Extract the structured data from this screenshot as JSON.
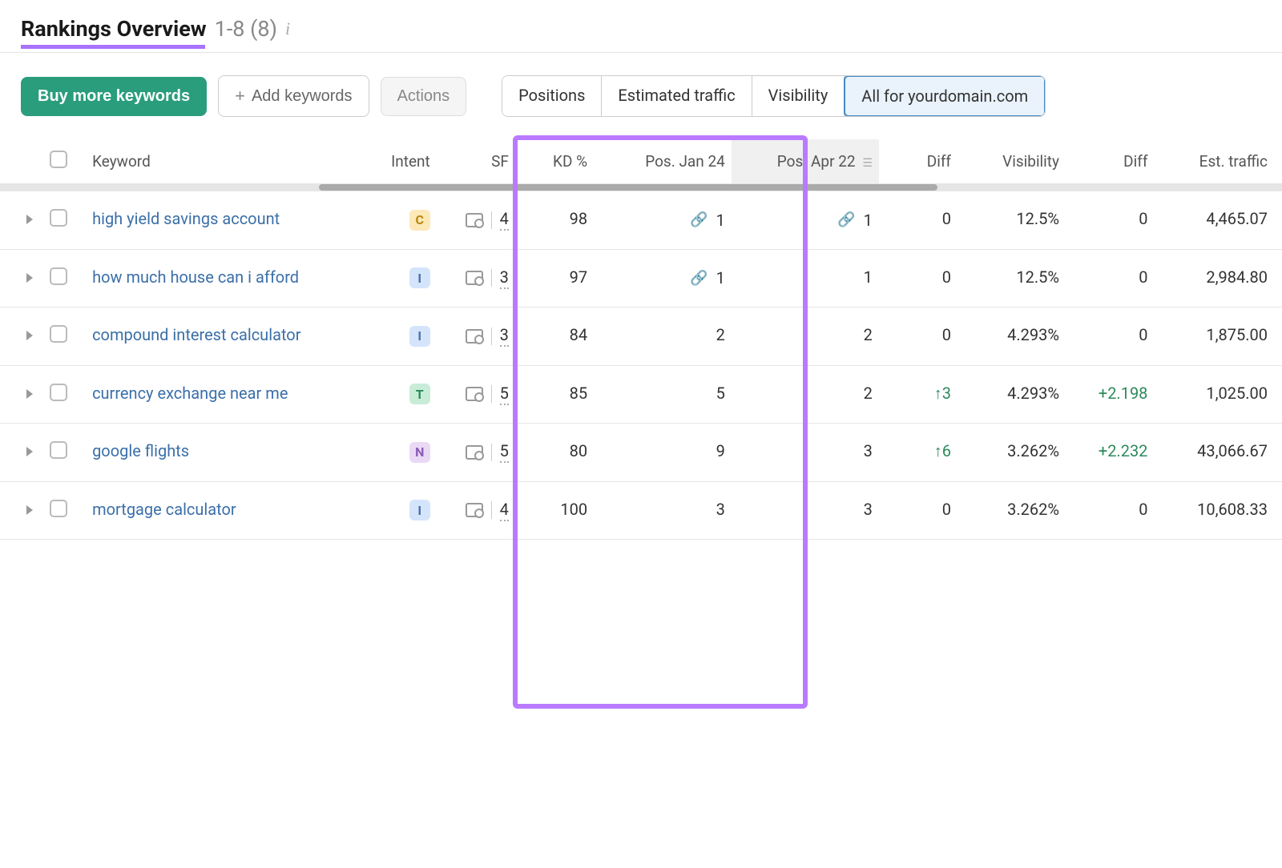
{
  "header": {
    "title": "Rankings Overview",
    "range": "1-8 (8)"
  },
  "toolbar": {
    "buy": "Buy more keywords",
    "add": "Add keywords",
    "actions": "Actions"
  },
  "tabs": {
    "positions": "Positions",
    "traffic": "Estimated traffic",
    "visibility": "Visibility",
    "all": "All for yourdomain.com"
  },
  "columns": {
    "keyword": "Keyword",
    "intent": "Intent",
    "sf": "SF",
    "kd": "KD %",
    "pos1": "Pos. Jan 24",
    "pos2": "Pos. Apr 22",
    "diff1": "Diff",
    "visibility": "Visibility",
    "diff2": "Diff",
    "est": "Est. traffic"
  },
  "rows": [
    {
      "keyword": "high yield savings account",
      "intent": "C",
      "sf": "4",
      "kd": "98",
      "pos1": "1",
      "pos1_icon": true,
      "pos2": "1",
      "pos2_icon": true,
      "diff1": "0",
      "diff1_up": false,
      "vis": "12.5%",
      "diff2": "0",
      "diff2_up": false,
      "est": "4,465.07"
    },
    {
      "keyword": "how much house can i afford",
      "intent": "I",
      "sf": "3",
      "kd": "97",
      "pos1": "1",
      "pos1_icon": true,
      "pos2": "1",
      "pos2_icon": false,
      "diff1": "0",
      "diff1_up": false,
      "vis": "12.5%",
      "diff2": "0",
      "diff2_up": false,
      "est": "2,984.80"
    },
    {
      "keyword": "compound interest calculator",
      "intent": "I",
      "sf": "3",
      "kd": "84",
      "pos1": "2",
      "pos1_icon": false,
      "pos2": "2",
      "pos2_icon": false,
      "diff1": "0",
      "diff1_up": false,
      "vis": "4.293%",
      "diff2": "0",
      "diff2_up": false,
      "est": "1,875.00"
    },
    {
      "keyword": "currency exchange near me",
      "intent": "T",
      "sf": "5",
      "kd": "85",
      "pos1": "5",
      "pos1_icon": false,
      "pos2": "2",
      "pos2_icon": false,
      "diff1": "3",
      "diff1_up": true,
      "vis": "4.293%",
      "diff2": "+2.198",
      "diff2_up": true,
      "est": "1,025.00"
    },
    {
      "keyword": "google flights",
      "intent": "N",
      "sf": "5",
      "kd": "80",
      "pos1": "9",
      "pos1_icon": false,
      "pos2": "3",
      "pos2_icon": false,
      "diff1": "6",
      "diff1_up": true,
      "vis": "3.262%",
      "diff2": "+2.232",
      "diff2_up": true,
      "est": "43,066.67"
    },
    {
      "keyword": "mortgage calculator",
      "intent": "I",
      "sf": "4",
      "kd": "100",
      "pos1": "3",
      "pos1_icon": false,
      "pos2": "3",
      "pos2_icon": false,
      "diff1": "0",
      "diff1_up": false,
      "vis": "3.262%",
      "diff2": "0",
      "diff2_up": false,
      "est": "10,608.33"
    }
  ]
}
